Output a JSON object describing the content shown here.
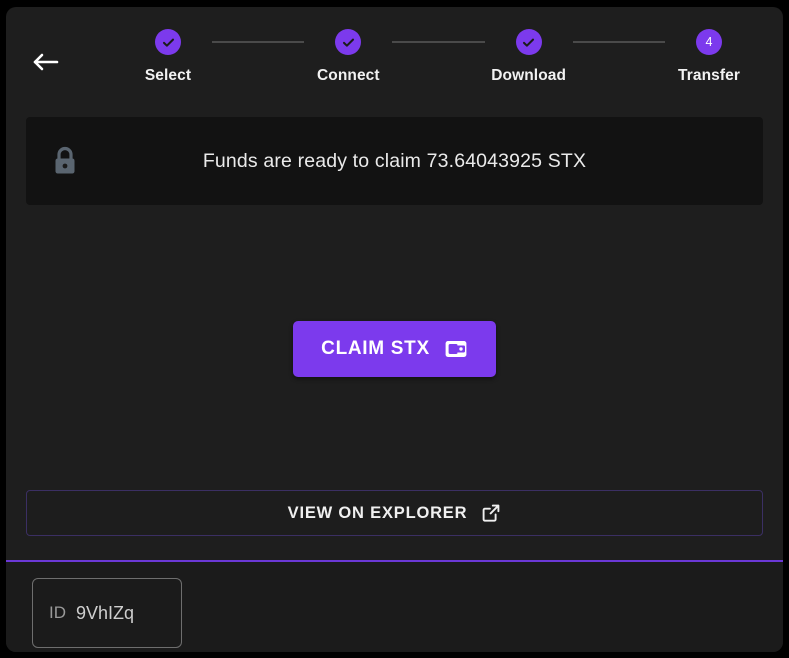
{
  "window": {
    "background_color": "#000000",
    "card_color": "#1e1e1e",
    "accent_color": "#7c3aed"
  },
  "header": {
    "back_icon": "arrow-left-icon",
    "stepper": {
      "steps": [
        {
          "label": "Select",
          "state": "complete",
          "marker": "✓"
        },
        {
          "label": "Connect",
          "state": "complete",
          "marker": "✓"
        },
        {
          "label": "Download",
          "state": "complete",
          "marker": "✓"
        },
        {
          "label": "Transfer",
          "state": "current",
          "marker": "4"
        }
      ]
    }
  },
  "status_banner": {
    "icon": "lock-icon",
    "message": "Funds are ready to claim 73.64043925 STX",
    "amount": "73.64043925",
    "currency": "STX"
  },
  "primary_action": {
    "label": "CLAIM STX",
    "icon": "wallet-icon",
    "color": "#7c3aed"
  },
  "secondary_action": {
    "label": "VIEW ON EXPLORER",
    "icon": "external-link-icon"
  },
  "footer": {
    "id_field": {
      "label": "ID",
      "value": "9VhIZq"
    }
  }
}
